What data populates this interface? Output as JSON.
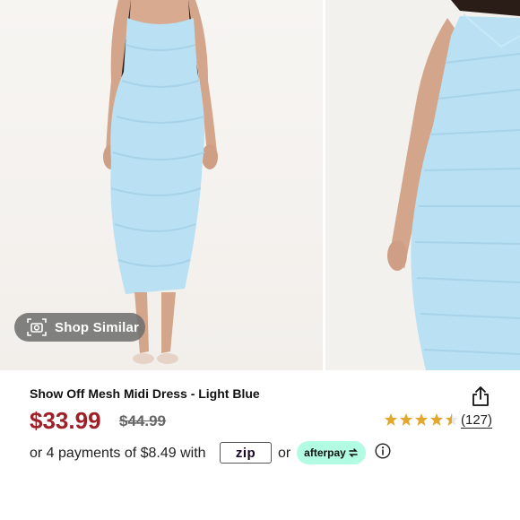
{
  "gallery": {
    "photos": [
      {
        "alt": "model front view",
        "dress_color": "#b9e1f3"
      },
      {
        "alt": "model side view",
        "dress_color": "#b9e1f3"
      }
    ],
    "shop_similar_label": "Shop Similar"
  },
  "product": {
    "title": "Show Off Mesh Midi Dress - Light Blue",
    "price": "$33.99",
    "original_price": "$44.99",
    "rating": 4.5,
    "review_count": "(127)"
  },
  "payments": {
    "text": "or 4 payments of $8.49 with",
    "zip_label": "zip",
    "or_text": "or",
    "afterpay_label": "afterpay"
  },
  "colors": {
    "sale_price": "#a01f26",
    "star": "#e2a72c",
    "afterpay_bg": "#b2fce4",
    "zip_accent": "#a58bf2"
  }
}
